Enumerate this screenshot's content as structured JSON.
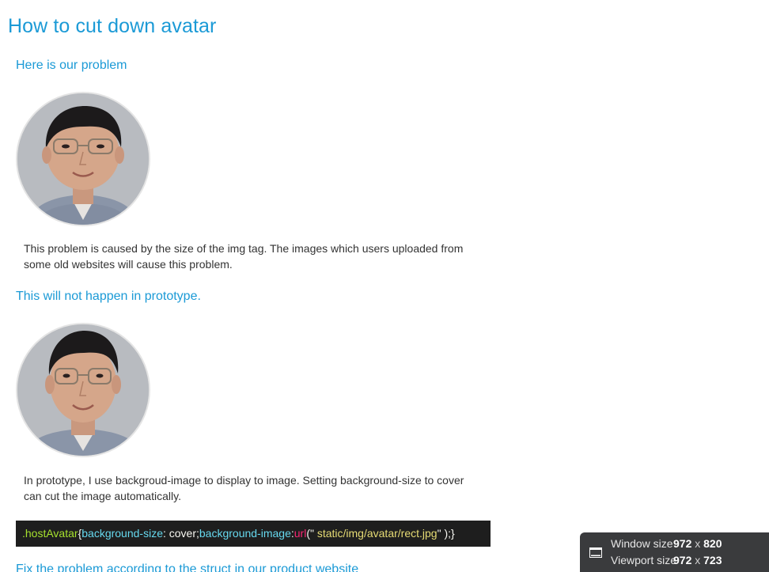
{
  "page": {
    "title": "How to cut down avatar"
  },
  "section1": {
    "heading": "Here is our problem",
    "paragraph_line1": "This problem is caused by the size of the img tag. The images which users uploaded from",
    "paragraph_line2": "some old websites will cause this problem."
  },
  "section2": {
    "heading": "This will not happen in prototype.",
    "paragraph_line1": "In prototype, I use backgroud-image to display to image. Setting background-size to cover",
    "paragraph_line2": "can cut the image automatically."
  },
  "code": {
    "selector": ".hostAvatar",
    "open_brace": "{",
    "prop1": "background-size",
    "colon1": ": ",
    "value1": "cover",
    "semi1": ";",
    "prop2": "background-image",
    "colon2": ":",
    "func": "url",
    "paren_open": "(\"",
    "string": " static/img/avatar/rect.jpg",
    "paren_close": "\" );}"
  },
  "section3": {
    "heading": "Fix the problem according to the struct in our product website"
  },
  "size_overlay": {
    "window_label": "Window size",
    "window_width": "972",
    "window_height": "820",
    "viewport_label": "Viewport size",
    "viewport_width": "972",
    "viewport_height": "723",
    "separator": "x",
    "icon": "window-icon"
  },
  "colors": {
    "heading_blue": "#1b9ad6",
    "body_text": "#333333",
    "code_background": "#1e1e1e",
    "overlay_background": "#3a3b3d"
  }
}
